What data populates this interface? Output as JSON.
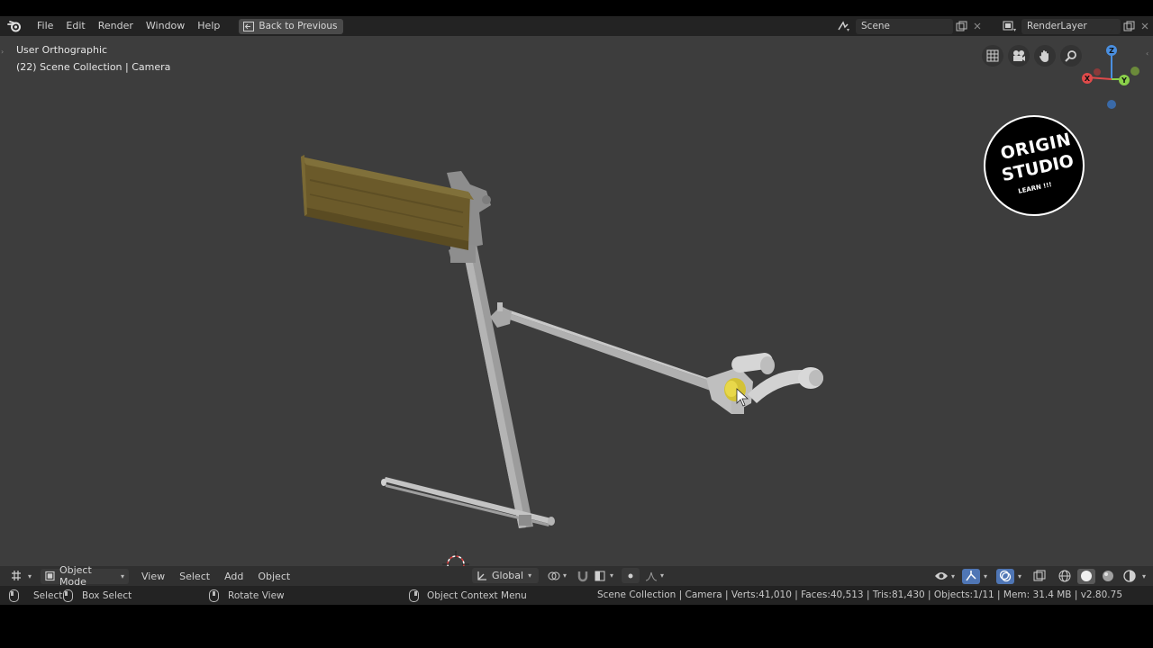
{
  "menubar": {
    "items": [
      "File",
      "Edit",
      "Render",
      "Window",
      "Help"
    ],
    "back_button": "Back to Previous",
    "scene_label": "Scene",
    "render_layer_label": "RenderLayer"
  },
  "viewport": {
    "view_name": "User Orthographic",
    "collection_info": "(22) Scene Collection | Camera",
    "nav_icons": [
      "grid-icon",
      "camera-icon",
      "hand-icon",
      "zoom-icon"
    ],
    "gizmo_axes": {
      "z": "Z",
      "x": "X",
      "y": "Y"
    }
  },
  "watermark": {
    "line1": "ORIGIN",
    "line2": "STUDIO",
    "line3": "LEARN !!!"
  },
  "header": {
    "mode": "Object Mode",
    "menus": [
      "View",
      "Select",
      "Add",
      "Object"
    ],
    "orientation": "Global"
  },
  "statusbar": {
    "select": "Select",
    "box_select": "Box Select",
    "rotate_view": "Rotate View",
    "context_menu": "Object Context Menu",
    "stats": "Scene Collection | Camera | Verts:41,010 | Faces:40,513 | Tris:81,430 | Objects:1/11 | Mem: 31.4 MB | v2.80.75"
  },
  "colors": {
    "viewport_bg": "#3d3d3d",
    "selected_object": "#6b5a2a",
    "model_gray": "#a9a9a9",
    "active_blue": "#4f76b5"
  }
}
